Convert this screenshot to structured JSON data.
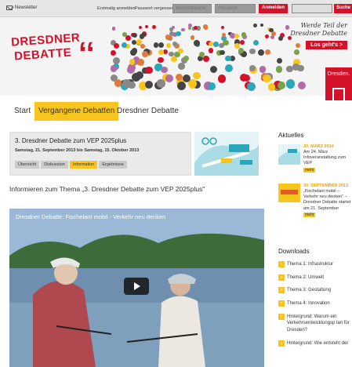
{
  "topbar": {
    "newsletter": "Newsletter",
    "first_login": "Erstmalig anmelden",
    "forgot_password": "Passwort vergessen?",
    "username_placeholder": "Benutzername",
    "password_placeholder": "Passwort",
    "login_button": "Anmelden",
    "search_button": "Suche"
  },
  "banner": {
    "logo_line1": "DRESDNER",
    "logo_line2": "DEBATTE",
    "tagline_line1": "Werde Teil der",
    "tagline_line2": "Dresdner Debatte",
    "cta": "Los geht's >",
    "side_brand": "Dresden."
  },
  "nav": {
    "items": [
      {
        "label": "Start",
        "active": false
      },
      {
        "label": "Vergangene Debatten",
        "active": true
      },
      {
        "label": "Dresdner Debatte",
        "active": false
      }
    ]
  },
  "event": {
    "title": "3. Dresdner Debatte zum VEP 2025plus",
    "dates": "Samstag, 21. September 2013 bis Samstag, 15. Oktober 2013",
    "tabs": [
      {
        "label": "Übersicht",
        "active": false
      },
      {
        "label": "Diskussion",
        "active": false
      },
      {
        "label": "Information",
        "active": true
      },
      {
        "label": "Ergebnisse",
        "active": false
      }
    ]
  },
  "content": {
    "subheading": "Informieren zum Thema „3. Dresdner Debatte zum VEP 2025plus\"",
    "video_title": "Dresdner Debatte: Fischelant mobil - Verkehr neu denken"
  },
  "sidebar": {
    "news_heading": "Aktuelles",
    "news": [
      {
        "date": "20. MÄRZ 2014",
        "text": "Am 24. März Infoveranstaltung zum VEP",
        "more": "mehr"
      },
      {
        "date": "30. SEPTEMBER 2013",
        "text": "„Fischelant mobil – Verkehr neu denken\" – Dresdner Debatte startet am 21. September",
        "more": "mehr"
      }
    ],
    "downloads_heading": "Downloads",
    "downloads": [
      "Thema 1: Infrastruktur",
      "Thema 2: Umwelt",
      "Thema 3: Gestaltung",
      "Thema 4: Innovation",
      "Hintergrund: Warum ein Verkehrsentwicklungsp lan für Dresden?",
      "Hintergrund: Wie entsteht der"
    ]
  },
  "colors": {
    "accent": "#f7c51d",
    "brand_red": "#d3122a"
  },
  "icons": {
    "newsletter": "envelope-icon",
    "play": "play-icon",
    "download": "arrow-right-icon"
  }
}
